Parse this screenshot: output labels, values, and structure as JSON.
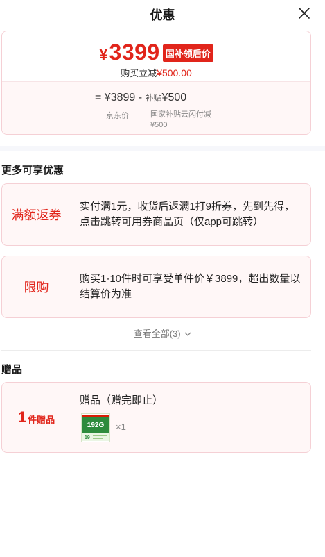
{
  "header": {
    "title": "优惠"
  },
  "price": {
    "currency": "¥",
    "amount": "3399",
    "tag": "国补领后价",
    "save_prefix": "购买立减",
    "save_amount": "¥500.00",
    "formula_prefix": "=",
    "jd_price": "¥3899",
    "minus": "-",
    "subsidy_word": "补贴",
    "subsidy_amount": "¥500",
    "jd_label": "京东价",
    "subsidy_label": "国家补贴云闪付减¥500"
  },
  "promotions": {
    "section_title": "更多可享优惠",
    "items": [
      {
        "label": "满额返券",
        "desc": "实付满1元，收货后返满1打9折券，先到先得，点击跳转可用券商品页（仅app可跳转）"
      },
      {
        "label": "限购",
        "desc": "购买1-10件时可享受单件价￥3899，超出数量以结算价为准"
      }
    ],
    "view_all": "查看全部(3)"
  },
  "gifts": {
    "section_title": "赠品",
    "count": "1",
    "unit": "件赠品",
    "name": "赠品（赠完即止）",
    "thumb_label": "192G",
    "quantity": "×1"
  },
  "colors": {
    "accent": "#e1251b",
    "card_bg": "#fff7f7",
    "card_border": "#f5d0d5"
  }
}
